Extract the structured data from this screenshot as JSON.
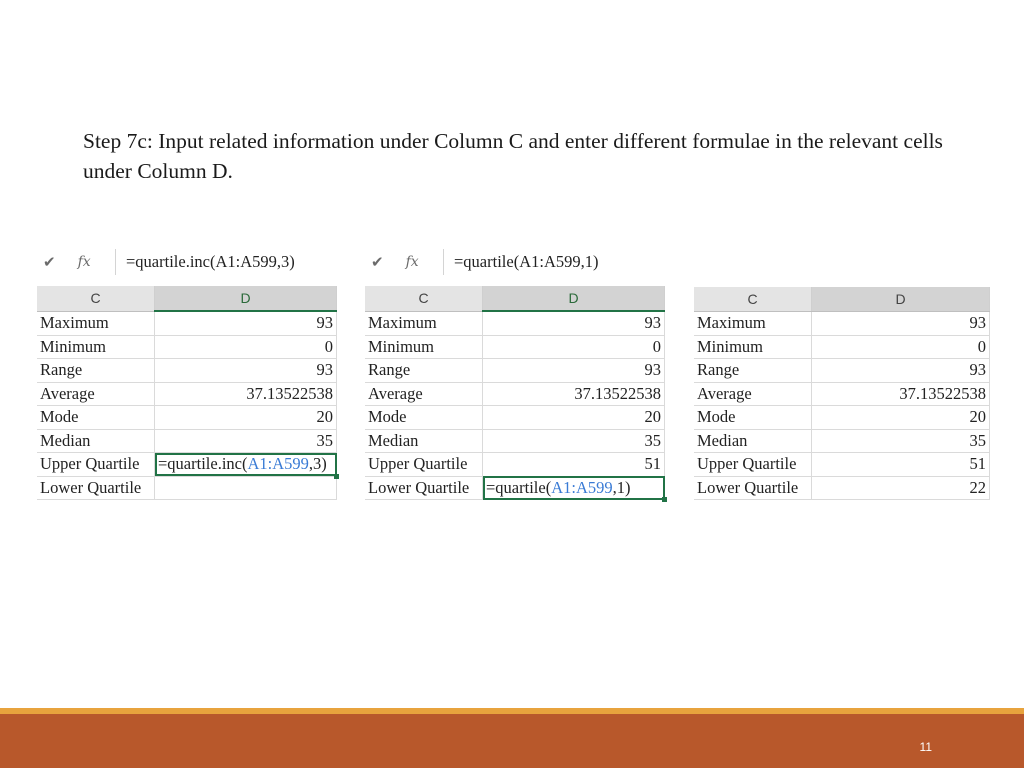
{
  "slide": {
    "text": "Step 7c: Input related information under Column C and enter different formulae in the relevant cells under Column D.",
    "page_number": "11"
  },
  "colors": {
    "accent_green": "#217346",
    "reference_blue": "#3a7bd5",
    "footer": "#b8582b",
    "footer_stripe": "#e8a33d"
  },
  "column_headers": {
    "c": "C",
    "d": "D"
  },
  "formula_bar": {
    "check_icon": "check-icon",
    "fx_label": "fx"
  },
  "sheet1": {
    "formula_bar": "=quartile.inc(A1:A599,3)",
    "rows": [
      {
        "label": "Maximum",
        "value": "93"
      },
      {
        "label": "Minimum",
        "value": "0"
      },
      {
        "label": "Range",
        "value": "93"
      },
      {
        "label": "Average",
        "value": "37.13522538"
      },
      {
        "label": "Mode",
        "value": "20"
      },
      {
        "label": "Median",
        "value": "35"
      },
      {
        "label": "Upper Quartile",
        "formula_pre": "=quartile.inc(",
        "formula_ref": "A1:A599",
        "formula_post": ",3)"
      },
      {
        "label": "Lower Quartile",
        "value": ""
      }
    ]
  },
  "sheet2": {
    "formula_bar": "=quartile(A1:A599,1)",
    "rows": [
      {
        "label": "Maximum",
        "value": "93"
      },
      {
        "label": "Minimum",
        "value": "0"
      },
      {
        "label": "Range",
        "value": "93"
      },
      {
        "label": "Average",
        "value": "37.13522538"
      },
      {
        "label": "Mode",
        "value": "20"
      },
      {
        "label": "Median",
        "value": "35"
      },
      {
        "label": "Upper Quartile",
        "value": "51"
      },
      {
        "label": "Lower Quartile",
        "formula_pre": "=quartile(",
        "formula_ref": "A1:A599",
        "formula_post": ",1)"
      }
    ]
  },
  "sheet3": {
    "rows": [
      {
        "label": "Maximum",
        "value": "93"
      },
      {
        "label": "Minimum",
        "value": "0"
      },
      {
        "label": "Range",
        "value": "93"
      },
      {
        "label": "Average",
        "value": "37.13522538"
      },
      {
        "label": "Mode",
        "value": "20"
      },
      {
        "label": "Median",
        "value": "35"
      },
      {
        "label": "Upper Quartile",
        "value": "51"
      },
      {
        "label": "Lower Quartile",
        "value": "22"
      }
    ]
  }
}
